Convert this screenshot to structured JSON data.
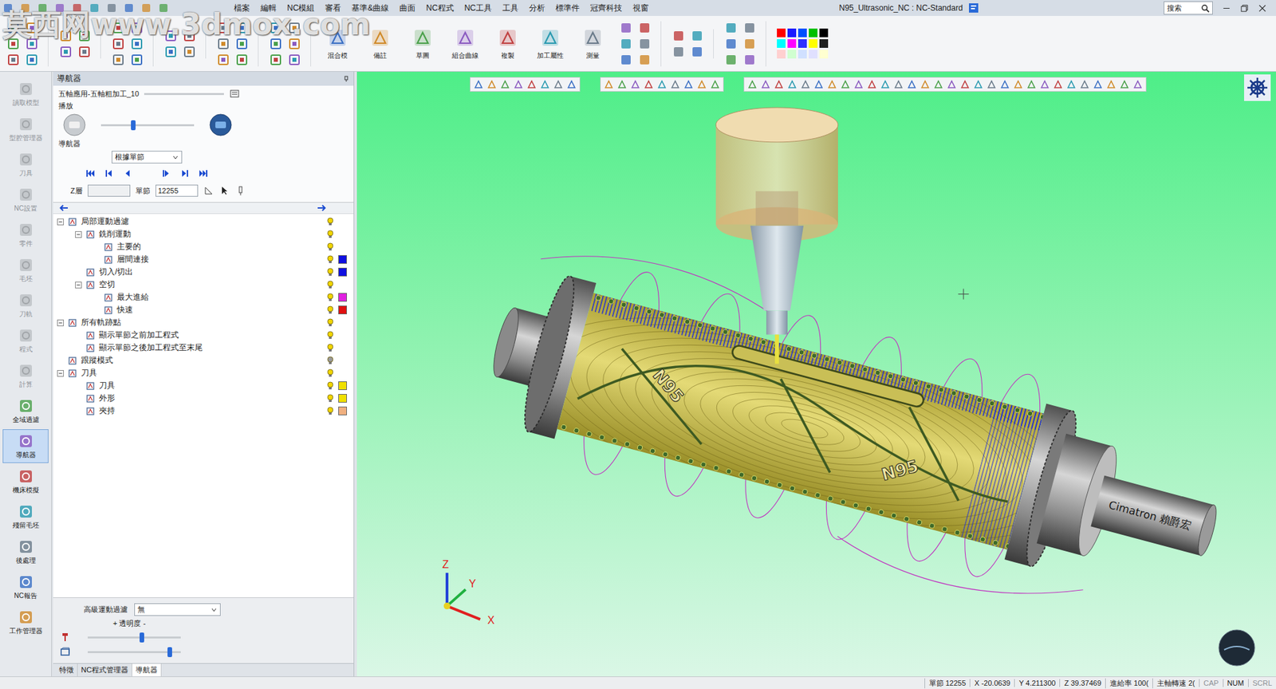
{
  "watermark": "莫西网www.3dmox.com",
  "window": {
    "title": "N95_Ultrasonic_NC : NC-Standard",
    "search": "搜索"
  },
  "menu": [
    {
      "label": "檔案"
    },
    {
      "label": "編輯"
    },
    {
      "label": "NC模組"
    },
    {
      "label": "審看"
    },
    {
      "label": "基準&曲線"
    },
    {
      "label": "曲面"
    },
    {
      "label": "NC程式"
    },
    {
      "label": "NC工具"
    },
    {
      "label": "工具"
    },
    {
      "label": "分析"
    },
    {
      "label": "標準件"
    },
    {
      "label": "冠齊科技"
    },
    {
      "label": "視窗"
    }
  ],
  "ribbon": {
    "buttons": [
      {
        "label": "混合模"
      },
      {
        "label": "備註"
      },
      {
        "label": "草圖"
      },
      {
        "label": "組合曲線"
      },
      {
        "label": "複製"
      },
      {
        "label": "加工屬性"
      },
      {
        "label": "測量"
      }
    ],
    "palette": [
      {
        "color": "#ff0000"
      },
      {
        "color": "#1a1aff"
      },
      {
        "color": "#0050ff"
      },
      {
        "color": "#00c000"
      },
      {
        "color": "#000000"
      },
      {
        "color": "#00ffff"
      },
      {
        "color": "#ff00ff"
      },
      {
        "color": "#3030ff"
      },
      {
        "color": "#ffff00"
      },
      {
        "color": "#202020"
      },
      {
        "color": "#ffd0d0"
      },
      {
        "color": "#d0ffd0"
      },
      {
        "color": "#d0e0ff"
      },
      {
        "color": "#e0e0ff"
      },
      {
        "color": "#ffffd0"
      }
    ]
  },
  "sidebar": {
    "items": [
      {
        "label": "讀取模型",
        "disabled": true,
        "selected": false
      },
      {
        "label": "型腔管理器",
        "disabled": true,
        "selected": false
      },
      {
        "label": "刀具",
        "disabled": true,
        "selected": false
      },
      {
        "label": "NC設置",
        "disabled": true,
        "selected": false
      },
      {
        "label": "零件",
        "disabled": true,
        "selected": false
      },
      {
        "label": "毛坯",
        "disabled": true,
        "selected": false
      },
      {
        "label": "刀軌",
        "disabled": true,
        "selected": false
      },
      {
        "label": "程式",
        "disabled": true,
        "selected": false
      },
      {
        "label": "計算",
        "disabled": true,
        "selected": false
      },
      {
        "label": "全域過濾",
        "disabled": false,
        "selected": false
      },
      {
        "label": "導航器",
        "disabled": false,
        "selected": true
      },
      {
        "label": "機床模擬",
        "disabled": false,
        "selected": false
      },
      {
        "label": "殘留毛坯",
        "disabled": false,
        "selected": false
      },
      {
        "label": "後處理",
        "disabled": false,
        "selected": false
      },
      {
        "label": "NC報告",
        "disabled": false,
        "selected": false
      },
      {
        "label": "工作管理器",
        "disabled": false,
        "selected": false
      }
    ]
  },
  "navigator": {
    "header": "導航器",
    "operation": "五軸應用-五軸粗加工_10",
    "operation_level": 0.0,
    "play_label": "播放",
    "play_level": 0.34,
    "nav_label": "導航器",
    "mode": "根據單節",
    "z_label": "Z層",
    "z_value": "",
    "block_label": "單節",
    "block_value": "12255",
    "tree": [
      {
        "label": "局部運動過濾",
        "expanded": true,
        "visible": true,
        "children": [
          {
            "label": "銑削運動",
            "expanded": true,
            "visible": true,
            "children": [
              {
                "label": "主要的",
                "visible": true
              },
              {
                "label": "層間連接",
                "visible": true,
                "color": "#1010e0"
              }
            ]
          },
          {
            "label": "切入/切出",
            "visible": true,
            "color": "#1010e0"
          },
          {
            "label": "空切",
            "expanded": true,
            "visible": true,
            "children": [
              {
                "label": "最大進給",
                "visible": true,
                "color": "#e020e0"
              },
              {
                "label": "快速",
                "visible": true,
                "color": "#e01010"
              }
            ]
          }
        ]
      },
      {
        "label": "所有軌跡點",
        "expanded": true,
        "visible": true,
        "children": [
          {
            "label": "顯示單節之前加工程式",
            "visible": true
          },
          {
            "label": "顯示單節之後加工程式至末尾",
            "visible": true
          }
        ]
      },
      {
        "label": "跟蹤模式",
        "visible": false
      },
      {
        "label": "刀具",
        "expanded": true,
        "visible": true,
        "children": [
          {
            "label": "刀具",
            "visible": true,
            "color": "#f0e000"
          },
          {
            "label": "外形",
            "visible": true,
            "color": "#f0e000"
          },
          {
            "label": "夾持",
            "visible": true,
            "color": "#f0b080"
          }
        ]
      }
    ],
    "filter_label": "高級運動過濾",
    "filter_value": "無",
    "transparency_label": "+ 透明度 -",
    "tool_transparency": 0.58,
    "model_transparency": 0.88
  },
  "tabs": [
    {
      "label": "特徵",
      "selected": false
    },
    {
      "label": "NC程式管理器",
      "selected": false
    },
    {
      "label": "導航器",
      "selected": true
    }
  ],
  "viewport": {
    "model_labels": [
      "N95",
      "N95"
    ],
    "shaft_label": "Cimatron 賴爵宏",
    "axes": {
      "x": "X",
      "y": "Y",
      "z": "Z"
    }
  },
  "status_bar": [
    {
      "text": "單節 12255",
      "active": true
    },
    {
      "text": "X -20.0639",
      "active": true
    },
    {
      "text": "Y 4.211300",
      "active": true
    },
    {
      "text": "Z 39.37469",
      "active": true
    },
    {
      "text": "進給率 100(",
      "active": true
    },
    {
      "text": "主軸轉速 2(",
      "active": true
    },
    {
      "text": "CAP",
      "active": false
    },
    {
      "text": "NUM",
      "active": true
    },
    {
      "text": "SCRL",
      "active": false
    }
  ]
}
